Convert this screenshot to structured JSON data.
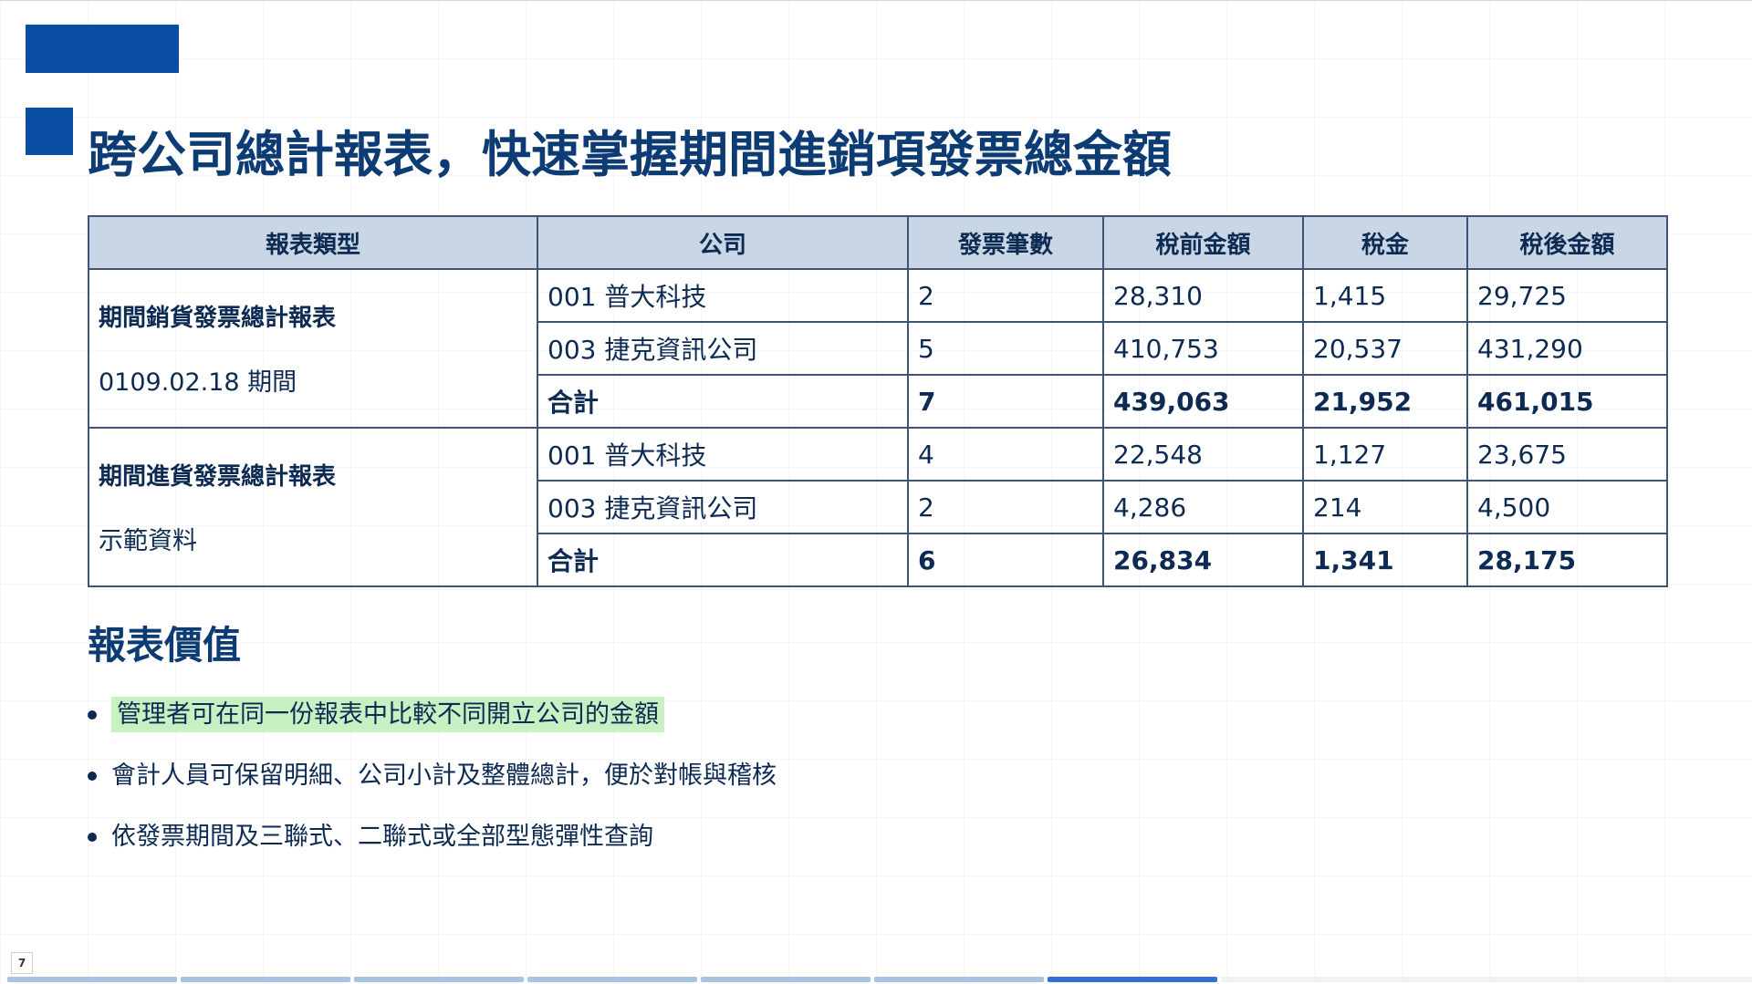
{
  "page": {
    "title": "跨公司總計報表，快速掌握期間進銷項發票總金額",
    "page_number": "7",
    "slide_count_visible": 7,
    "current_slide": 7
  },
  "colors": {
    "brand": "#0a4ea3",
    "heading": "#0d3b73",
    "table_header_bg": "#c9d6e5",
    "highlight": "#c8f0c2",
    "progress_active": "#2f6fd6",
    "progress_done": "#a9c3e3"
  },
  "table": {
    "headers": [
      "報表類型",
      "公司",
      "發票筆數",
      "稅前金額",
      "稅金",
      "稅後金額"
    ],
    "groups": [
      {
        "type_name": "期間銷貨發票總計報表",
        "type_sub": "0109.02.18 期間",
        "rows": [
          [
            "001 普大科技",
            "2",
            "28,310",
            "1,415",
            "29,725"
          ],
          [
            "003 捷克資訊公司",
            "5",
            "410,753",
            "20,537",
            "431,290"
          ]
        ],
        "total": [
          "合計",
          "7",
          "439,063",
          "21,952",
          "461,015"
        ]
      },
      {
        "type_name": "期間進貨發票總計報表",
        "type_sub": "示範資料",
        "rows": [
          [
            "001 普大科技",
            "4",
            "22,548",
            "1,127",
            "23,675"
          ],
          [
            "003 捷克資訊公司",
            "2",
            "4,286",
            "214",
            "4,500"
          ]
        ],
        "total": [
          "合計",
          "6",
          "26,834",
          "1,341",
          "28,175"
        ]
      }
    ]
  },
  "value_section": {
    "heading": "報表價值",
    "bullets": [
      "管理者可在同一份報表中比較不同開立公司的金額",
      "會計人員可保留明細、公司小計及整體總計，便於對帳與稽核",
      "依發票期間及三聯式、二聯式或全部型態彈性查詢"
    ]
  }
}
